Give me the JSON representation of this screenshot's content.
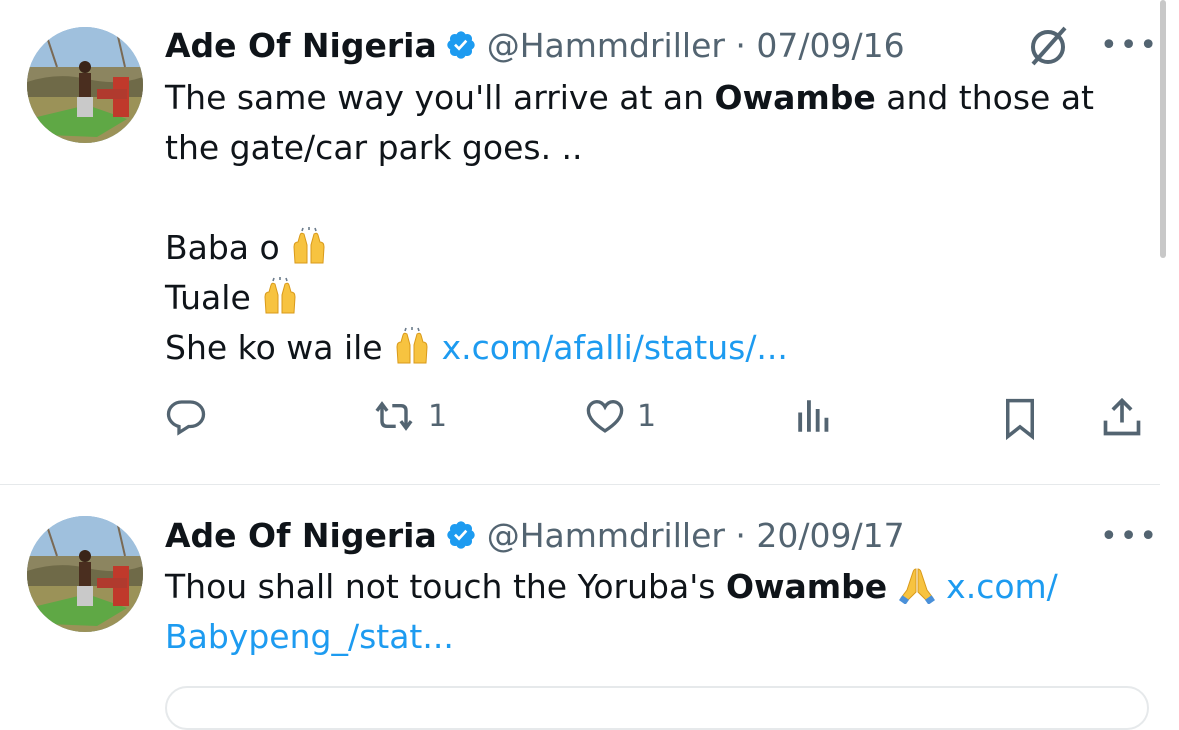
{
  "tweets": [
    {
      "name": "Ade Of Nigeria",
      "handle": "@Hammdriller",
      "date": "07/09/16",
      "line1_pre": "The same way you'll arrive at an ",
      "line1_bold": "Owambe",
      "line1_post": " and those at",
      "line2": "the gate/car park goes. ..",
      "line3": "Baba o ",
      "line4": "Tuale ",
      "line5": "She ko wa ile ",
      "link": "x.com/afalli/status/...",
      "emoji": "raising-hands-icon",
      "actions": {
        "reply_count": "",
        "repost_count": "1",
        "like_count": "1",
        "views_count": ""
      }
    },
    {
      "name": "Ade Of Nigeria",
      "handle": "@Hammdriller",
      "date": "20/09/17",
      "line1_pre": "Thou shall not touch the Yoruba's ",
      "line1_bold": "Owambe",
      "link_part1": "x.com/",
      "link_part2": "Babypeng_/stat...",
      "emoji": "folded-hands-icon"
    }
  ],
  "separator": " · ",
  "more_label": "•••",
  "colors": {
    "text": "#0f1419",
    "secondary": "#536471",
    "link": "#1d9bf0",
    "verified": "#1d9bf0"
  }
}
